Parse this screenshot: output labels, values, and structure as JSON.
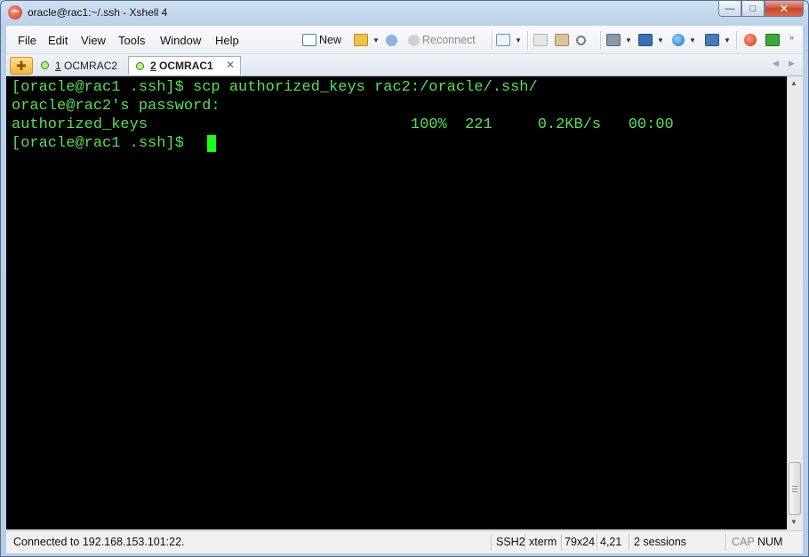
{
  "window": {
    "title": "oracle@rac1:~/.ssh - Xshell 4",
    "controls": {
      "minimize": "—",
      "maximize": "□",
      "close": "✕"
    }
  },
  "menu": [
    "File",
    "Edit",
    "View",
    "Tools",
    "Window",
    "Help"
  ],
  "toolbar": {
    "new_label": "New",
    "reconnect_label": "Reconnect"
  },
  "tabs": [
    {
      "num": "1",
      "name": "OCMRAC2",
      "active": false
    },
    {
      "num": "2",
      "name": "OCMRAC1",
      "active": true
    }
  ],
  "terminal": {
    "lines": [
      "[oracle@rac1 .ssh]$ scp authorized_keys rac2:/oracle/.ssh/",
      "oracle@rac2's password:",
      "authorized_keys                             100%  221     0.2KB/s   00:00",
      "[oracle@rac1 .ssh]$ "
    ],
    "text_color": "#55e055",
    "background": "#000000"
  },
  "status": {
    "connection": "Connected to 192.168.153.101:22.",
    "protocol": "SSH2",
    "term": "xterm",
    "size": "79x24",
    "cursor_pos": "4,21",
    "sessions": "2 sessions",
    "caps": "CAP",
    "num": "NUM"
  },
  "colors": {
    "accent": "#f2b436",
    "terminal_green": "#55e055",
    "cursor": "#19ff19"
  }
}
